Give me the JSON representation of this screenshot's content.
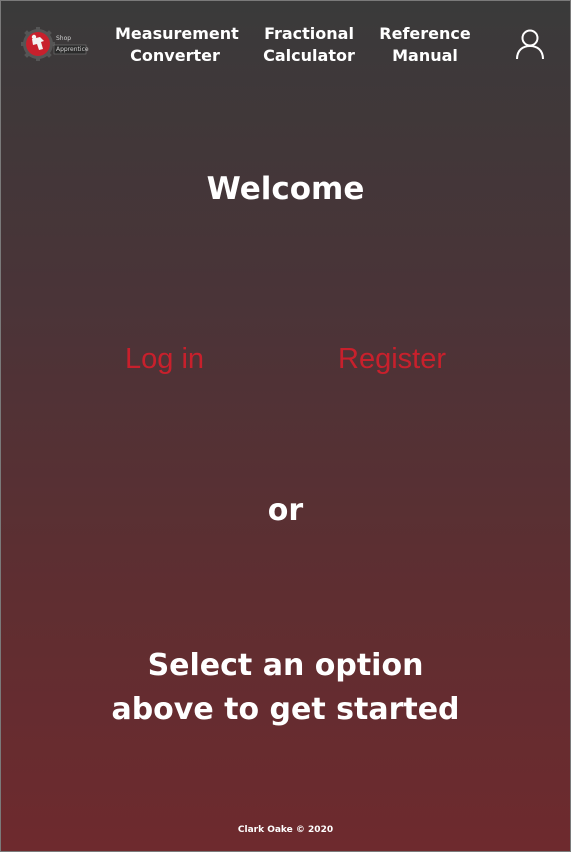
{
  "brand": {
    "line1": "Shop",
    "line2": "Apprentice",
    "accent_color": "#c8202c"
  },
  "nav": {
    "measurement_converter": "Measurement\nConverter",
    "fractional_calculator": "Fractional\nCalculator",
    "reference_manual": "Reference\nManual",
    "user_icon": "user-icon"
  },
  "main": {
    "welcome": "Welcome",
    "login": "Log in",
    "register": "Register",
    "or": "or",
    "cta_line1": "Select an option",
    "cta_line2": "above to get started"
  },
  "footer": {
    "copyright": "Clark Oake © 2020"
  },
  "colors": {
    "gradient_top": "#3a3a3a",
    "gradient_bottom": "#6e2a2e",
    "link_red": "#c8202c",
    "text_white": "#ffffff"
  }
}
